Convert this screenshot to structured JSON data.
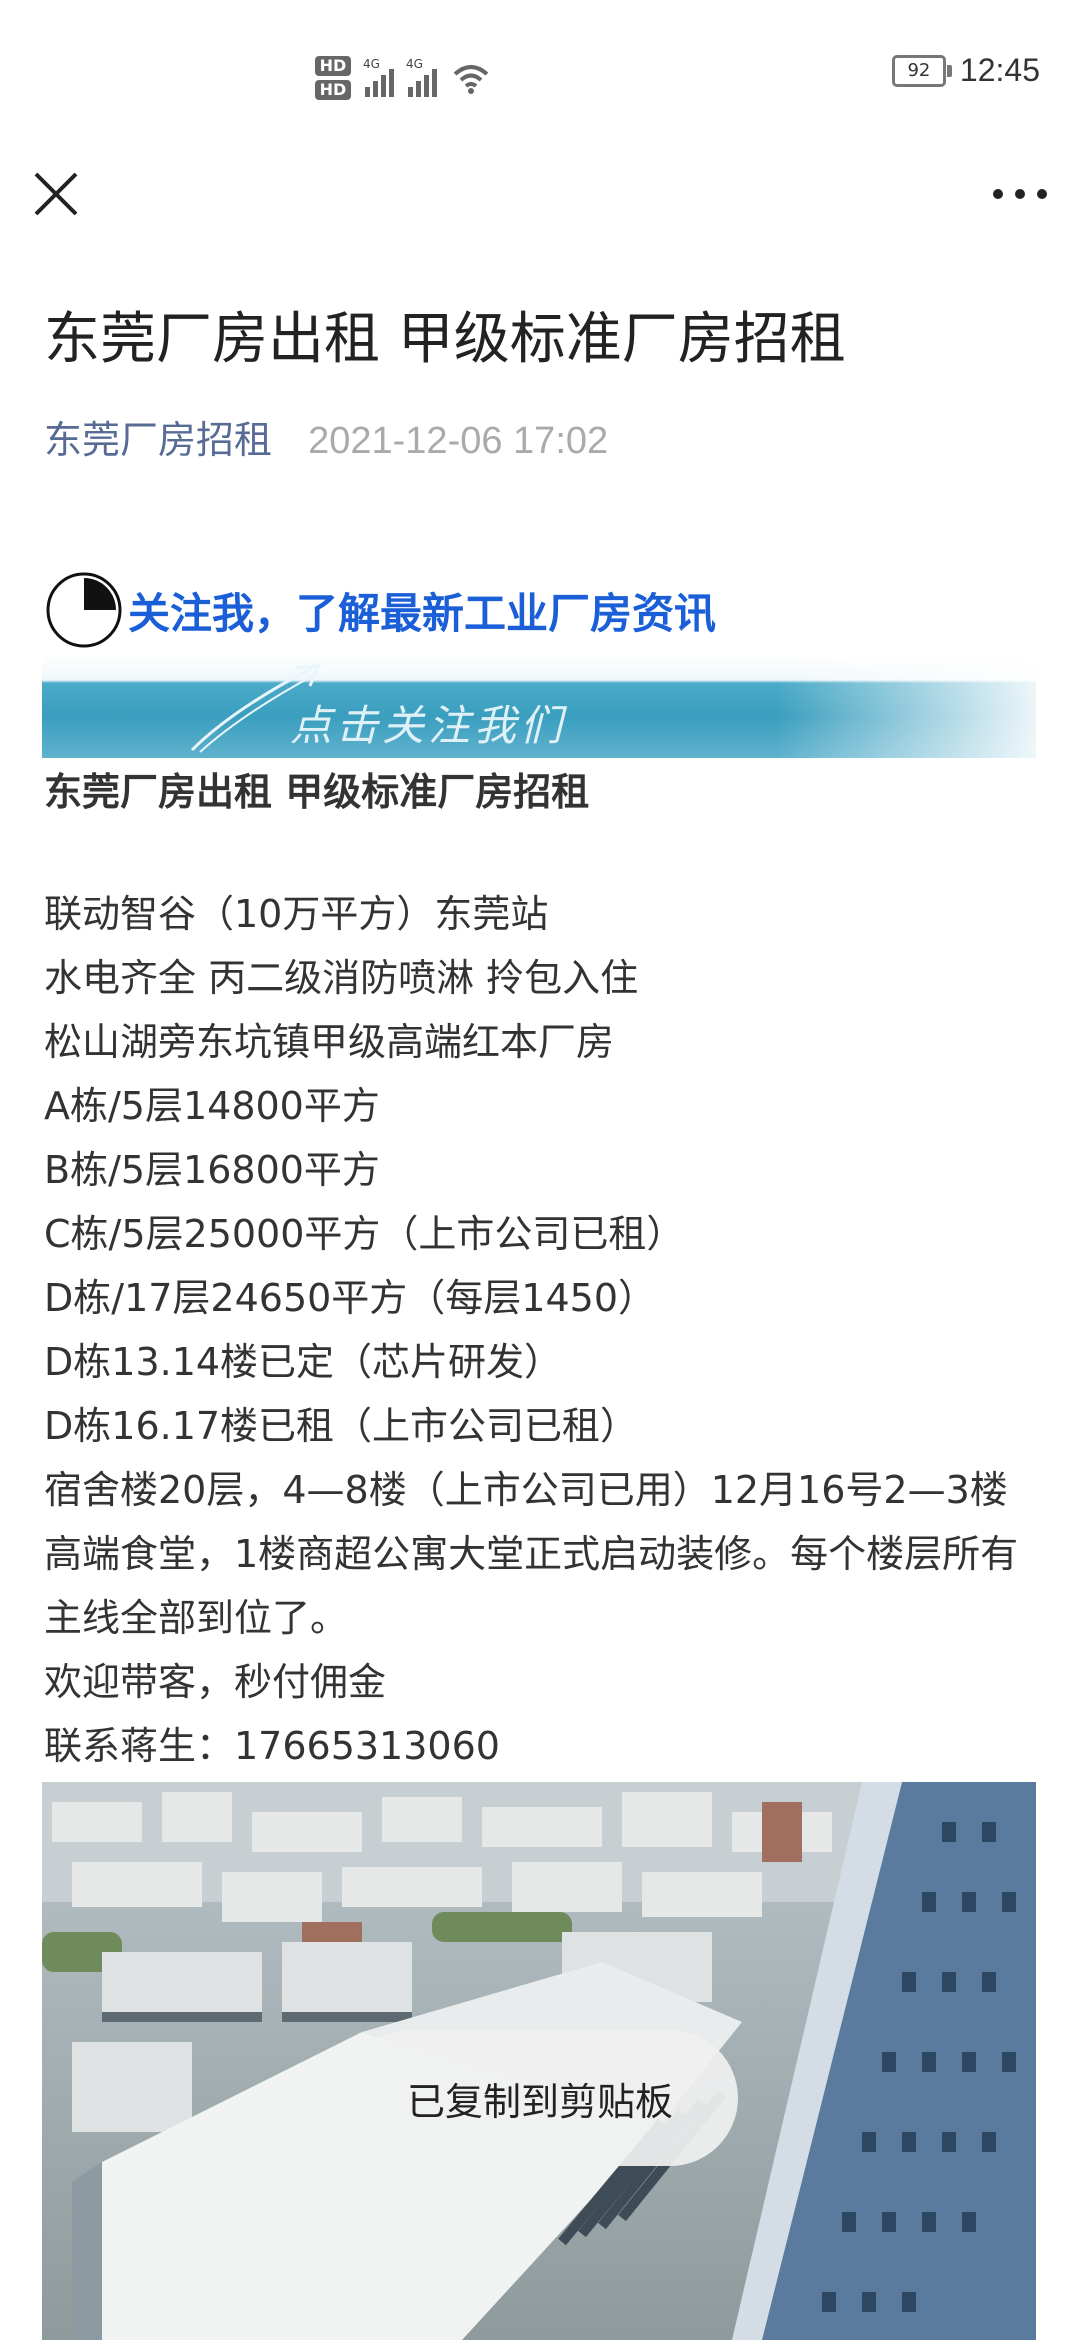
{
  "status_bar": {
    "hd1": "HD",
    "hd2": "HD",
    "net1": "4G",
    "net2": "4G",
    "battery": "92",
    "time": "12:45"
  },
  "nav": {
    "close_icon": "close-icon",
    "more_icon": "more-icon"
  },
  "article": {
    "title": "东莞厂房出租 甲级标准厂房招租",
    "author": "东莞厂房招租",
    "date": "2021-12-06 17:02",
    "follow_text": "关注我，了解最新工业厂房资讯",
    "banner_text": "点击关注我们",
    "body_title": "东莞厂房出租 甲级标准厂房招租",
    "lines": [
      "联动智谷（10万平方）东莞站",
      "水电齐全 丙二级消防喷淋 拎包入住",
      "松山湖旁东坑镇甲级高端红本厂房",
      "A栋/5层14800平方",
      "B栋/5层16800平方",
      "C栋/5层25000平方（上市公司已租）",
      "D栋/17层24650平方（每层1450）",
      "D栋13.14楼已定（芯片研发）",
      "D栋16.17楼已租（上市公司已租）",
      "宿舍楼20层，4—8楼（上市公司已用）12月16号2—3楼高端食堂，1楼商超公寓大堂正式启动装修。每个楼层所有主线全部到位了。",
      "欢迎带客，秒付佣金",
      "联系蒋生：17665313060"
    ]
  },
  "toast": {
    "text": "已复制到剪贴板"
  },
  "colors": {
    "author": "#576b95",
    "follow": "#1a5fd8",
    "banner": "#3a9ebe"
  }
}
